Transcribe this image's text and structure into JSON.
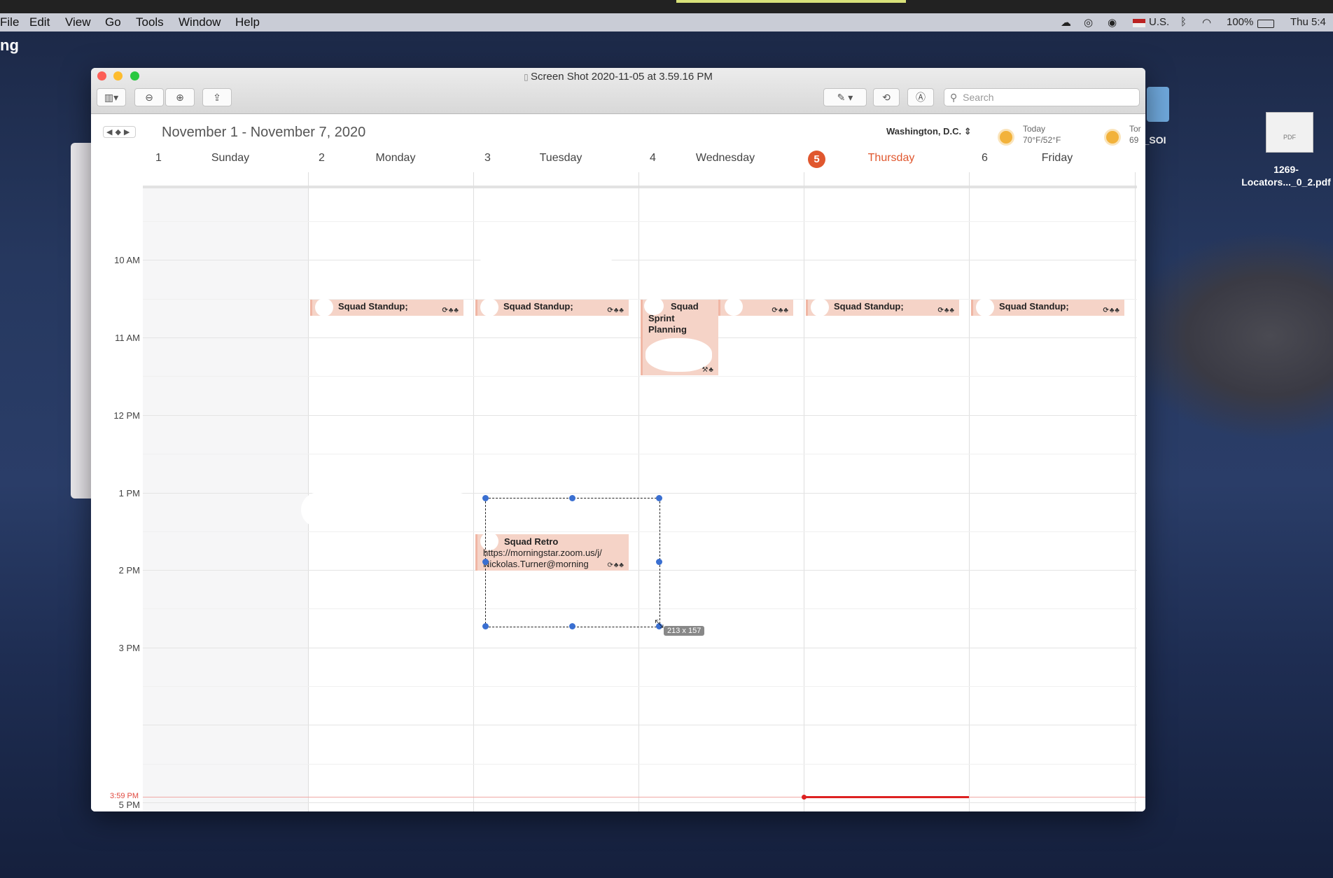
{
  "menubar": {
    "items": [
      "File",
      "Edit",
      "View",
      "Go",
      "Tools",
      "Window",
      "Help"
    ],
    "language": "U.S.",
    "battery": "100%",
    "clock": "Thu 5:4"
  },
  "desktop": {
    "left_fragment": "ng",
    "se_label": "se_SOI",
    "pdf_icon_text": "PDF",
    "pdf_label_line1": "1269-",
    "pdf_label_line2": "Locators..._0_2.pdf"
  },
  "window": {
    "title": "Screen Shot 2020-11-05 at 3.59.16 PM",
    "search_placeholder": "Search"
  },
  "calendar": {
    "range": "November 1 - November 7, 2020",
    "location": "Washington, D.C.",
    "weather_today_label": "Today",
    "weather_today_temp": "70°F/52°F",
    "weather_next_label": "Tor",
    "weather_next_temp": "69",
    "days": [
      {
        "num": "1",
        "name": "Sunday"
      },
      {
        "num": "2",
        "name": "Monday"
      },
      {
        "num": "3",
        "name": "Tuesday"
      },
      {
        "num": "4",
        "name": "Wednesday"
      },
      {
        "num": "5",
        "name": "Thursday"
      },
      {
        "num": "6",
        "name": "Friday"
      }
    ],
    "hours": [
      "10 AM",
      "11 AM",
      "12 PM",
      "1 PM",
      "2 PM",
      "3 PM",
      "5 PM"
    ],
    "now_label": "3:59 PM",
    "events": {
      "standup": "Squad Standup;",
      "sprint_line1": "Squad",
      "sprint_line2": "Sprint",
      "sprint_line3": "Planning",
      "retro_line1": "Squad Retro",
      "retro_line2": "https://morningstar.zoom.us/j/",
      "retro_line3": "Nickolas.Turner@morning"
    },
    "selection_size": "213 x 157"
  },
  "colors": {
    "accent_today": "#e0572e",
    "event_bg": "#f5d3c7",
    "now_line": "#dd2222",
    "selection_handle": "#3a6fd1"
  }
}
